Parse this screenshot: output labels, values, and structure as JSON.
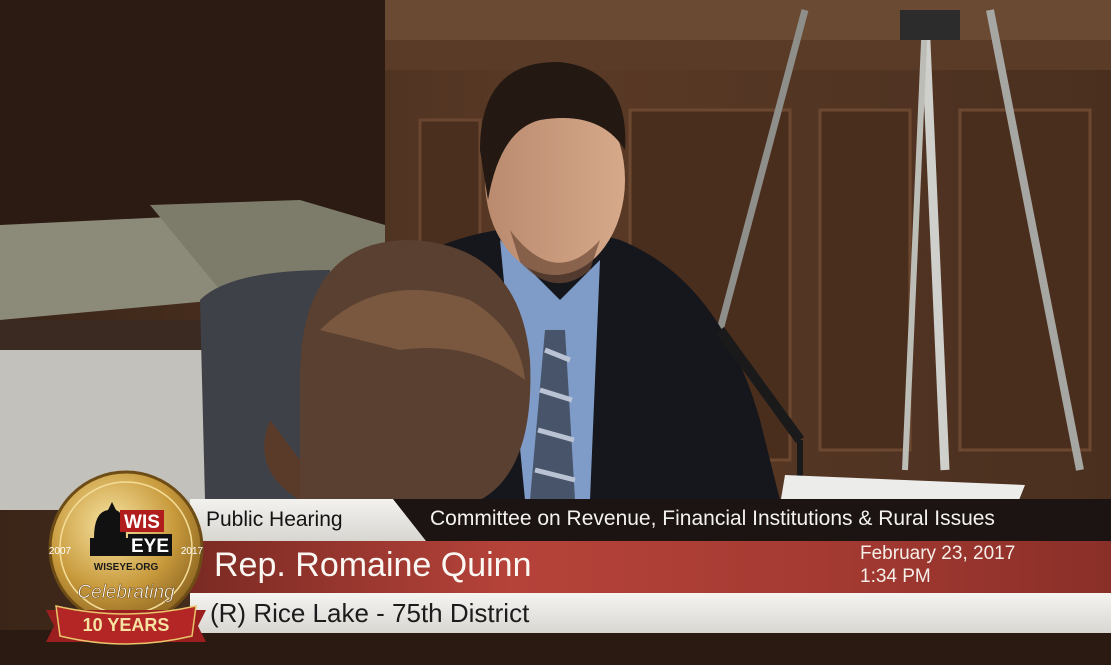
{
  "broadcast": {
    "event_type": "Public Hearing",
    "committee": "Committee on Revenue, Financial Institutions & Rural Issues",
    "speaker_name": "Rep. Romaine Quinn",
    "speaker_district": "(R) Rice Lake - 75th District",
    "date": "February 23, 2017",
    "time": "1:34 PM"
  },
  "logo": {
    "wis": "WIS",
    "eye": "EYE",
    "url": "WISEYE.ORG",
    "year_start": "2007",
    "year_end": "2017",
    "celebrating": "Celebrating",
    "years": "10 YEARS"
  },
  "colors": {
    "name_bar": "#b6433a",
    "logo_gold": "#c89a3c",
    "banner_red": "#9c1f1f"
  }
}
